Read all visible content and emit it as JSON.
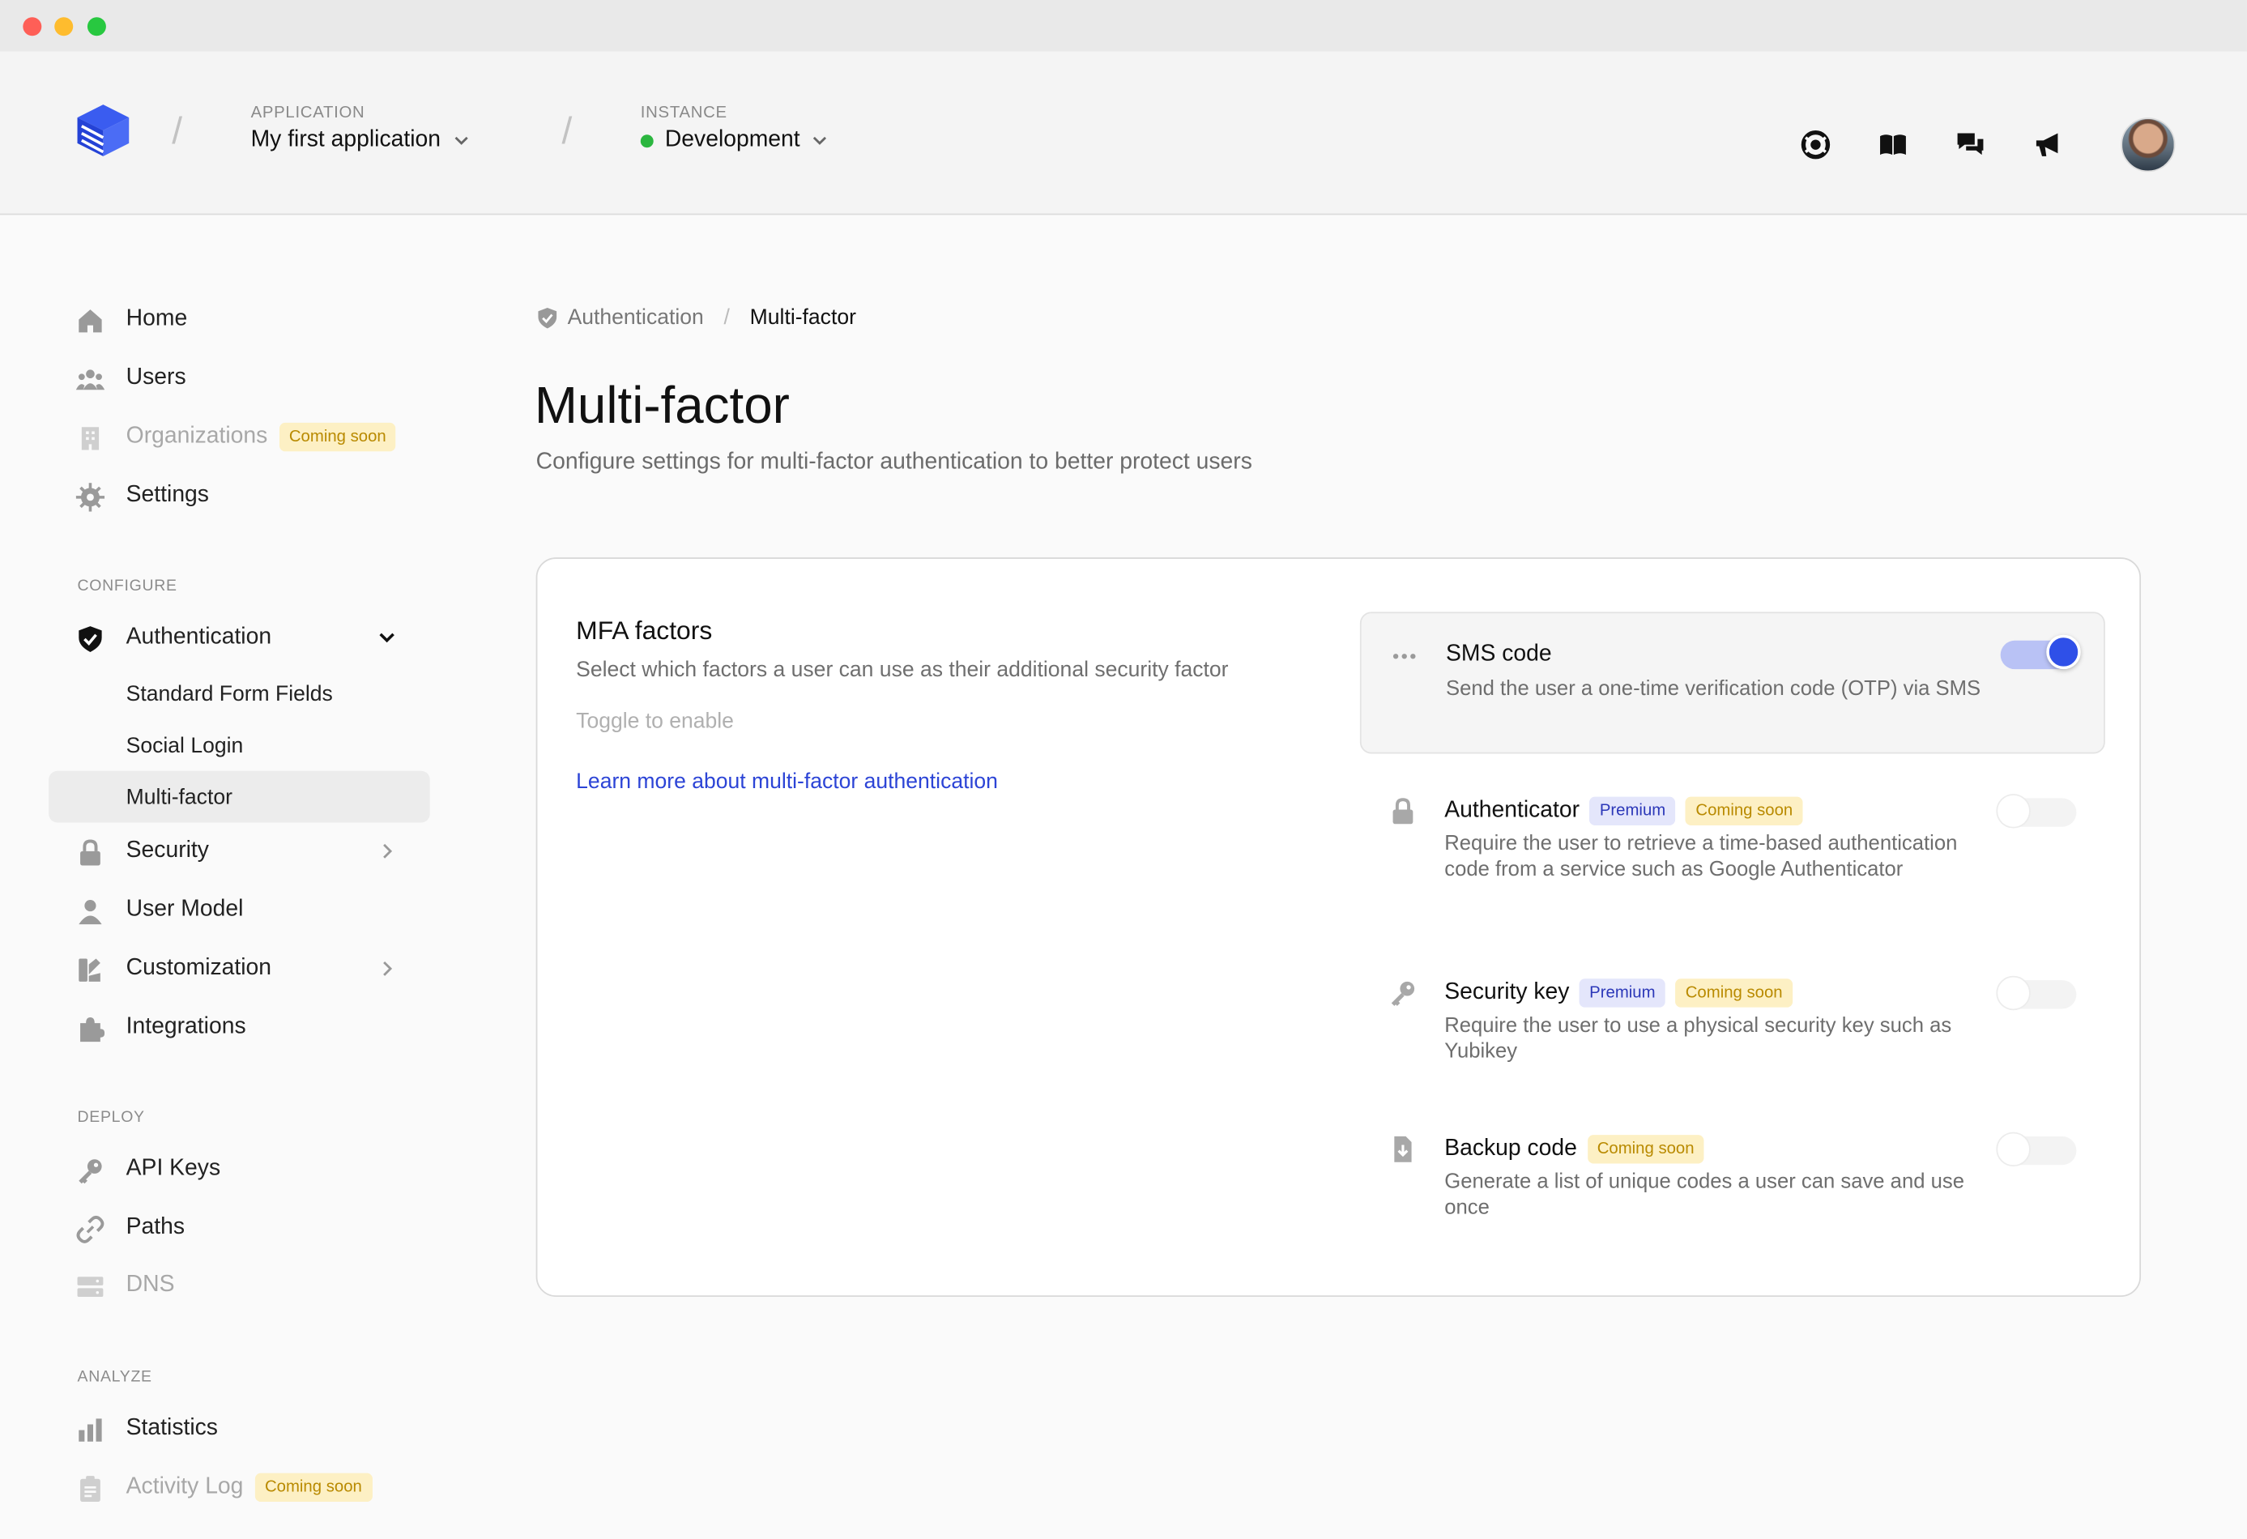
{
  "header": {
    "application_caption": "APPLICATION",
    "application_name": "My first application",
    "instance_caption": "INSTANCE",
    "instance_name": "Development",
    "icons": [
      "help-icon",
      "docs-icon",
      "chat-icon",
      "announce-icon"
    ]
  },
  "sidebar": {
    "home": "Home",
    "users": "Users",
    "organizations": "Organizations",
    "organizations_badge": "Coming soon",
    "settings": "Settings",
    "configure_caption": "CONFIGURE",
    "authentication": "Authentication",
    "standard_form_fields": "Standard Form Fields",
    "social_login": "Social Login",
    "multi_factor": "Multi-factor",
    "security": "Security",
    "user_model": "User Model",
    "customization": "Customization",
    "integrations": "Integrations",
    "deploy_caption": "DEPLOY",
    "api_keys": "API Keys",
    "paths": "Paths",
    "dns": "DNS",
    "analyze_caption": "ANALYZE",
    "statistics": "Statistics",
    "activity_log": "Activity Log",
    "activity_log_badge": "Coming soon"
  },
  "breadcrumb": {
    "parent": "Authentication",
    "current": "Multi-factor"
  },
  "page": {
    "title": "Multi-factor",
    "subtitle": "Configure settings for multi-factor authentication to better protect users"
  },
  "card": {
    "title": "MFA factors",
    "description": "Select which factors a user can use as their additional security factor",
    "hint": "Toggle to enable",
    "link": "Learn more about multi-factor authentication"
  },
  "factors": [
    {
      "title": "SMS code",
      "description": "Send the user a one-time verification code (OTP) via SMS",
      "enabled": true,
      "badges": []
    },
    {
      "title": "Authenticator",
      "description": "Require the user to retrieve a time-based authentication code from a service such as Google Authenticator",
      "enabled": false,
      "premium": "Premium",
      "soon": "Coming soon"
    },
    {
      "title": "Security key",
      "description": "Require the user to use a physical security key such as Yubikey",
      "enabled": false,
      "premium": "Premium",
      "soon": "Coming soon"
    },
    {
      "title": "Backup code",
      "description": "Generate a list of unique codes a user can save and use once",
      "enabled": false,
      "soon": "Coming soon"
    }
  ],
  "colors": {
    "accent": "#2f50e8",
    "link": "#2c44d6",
    "status_green": "#2bb63f",
    "soon_bg": "#fdf0c4",
    "premium_bg": "#e4e6fb"
  }
}
